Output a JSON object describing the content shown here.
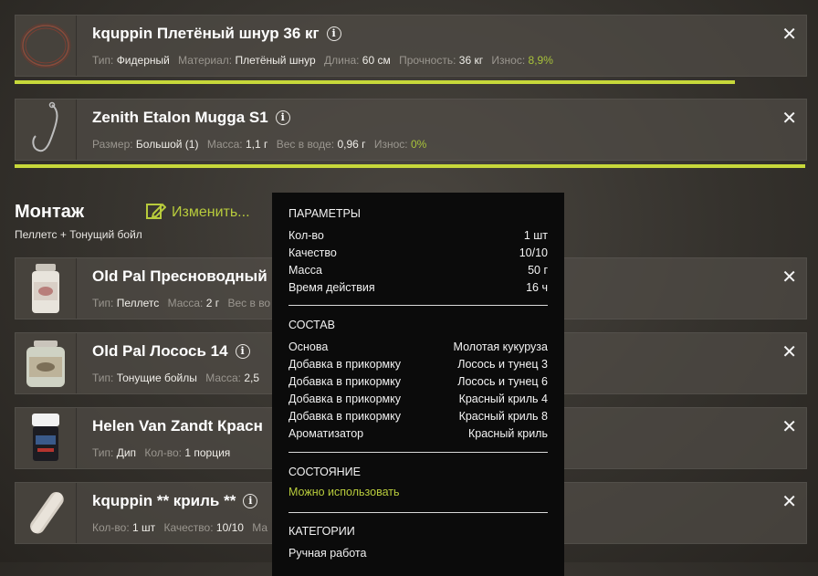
{
  "items": [
    {
      "title": "kquppin Плетёный шнур 36 кг",
      "meta": [
        {
          "k": "Тип:",
          "v": "Фидерный"
        },
        {
          "k": "Материал:",
          "v": "Плетёный шнур"
        },
        {
          "k": "Длина:",
          "v": "60 см"
        },
        {
          "k": "Прочность:",
          "v": "36 кг"
        },
        {
          "k": "Износ:",
          "v": "8,9%",
          "green": true
        }
      ],
      "wear_remaining": 0.91
    },
    {
      "title": "Zenith Etalon Mugga S1",
      "meta": [
        {
          "k": "Размер:",
          "v": "Большой (1)"
        },
        {
          "k": "Масса:",
          "v": "1,1 г"
        },
        {
          "k": "Вес в воде:",
          "v": "0,96 г"
        },
        {
          "k": "Износ:",
          "v": "0%",
          "green": true
        }
      ],
      "wear_remaining": 1.0
    }
  ],
  "montage": {
    "title": "Монтаж",
    "edit_label": "Изменить...",
    "subtitle": "Пеллетс + Тонущий бойл"
  },
  "baits": [
    {
      "title": "Old Pal Пресноводный",
      "meta": [
        {
          "k": "Тип:",
          "v": "Пеллетс"
        },
        {
          "k": "Масса:",
          "v": "2 г"
        },
        {
          "k": "Вес в во",
          "v": ""
        }
      ]
    },
    {
      "title": "Old Pal Лосось 14",
      "meta": [
        {
          "k": "Тип:",
          "v": "Тонущие бойлы"
        },
        {
          "k": "Масса:",
          "v": "2,5"
        }
      ]
    },
    {
      "title": "Helen Van Zandt Красн",
      "meta": [
        {
          "k": "Тип:",
          "v": "Дип"
        },
        {
          "k": "Кол-во:",
          "v": "1 порция"
        }
      ]
    },
    {
      "title": "kquppin ** криль **",
      "meta": [
        {
          "k": "Кол-во:",
          "v": "1 шт"
        },
        {
          "k": "Качество:",
          "v": "10/10"
        },
        {
          "k": "Ма",
          "v": ""
        }
      ]
    }
  ],
  "tooltip": {
    "params_title": "ПАРАМЕТРЫ",
    "params": [
      {
        "label": "Кол-во",
        "value": "1 шт"
      },
      {
        "label": "Качество",
        "value": "10/10"
      },
      {
        "label": "Масса",
        "value": "50 г"
      },
      {
        "label": "Время действия",
        "value": "16 ч"
      }
    ],
    "composition_title": "СОСТАВ",
    "composition": [
      {
        "label": "Основа",
        "value": "Молотая кукуруза"
      },
      {
        "label": "Добавка в прикормку",
        "value": "Лосось и тунец 3"
      },
      {
        "label": "Добавка в прикормку",
        "value": "Лосось и тунец 6"
      },
      {
        "label": "Добавка в прикормку",
        "value": "Красный криль 4"
      },
      {
        "label": "Добавка в прикормку",
        "value": "Красный криль 8"
      },
      {
        "label": "Ароматизатор",
        "value": "Красный криль"
      }
    ],
    "state_title": "СОСТОЯНИЕ",
    "state_value": "Можно использовать",
    "categories_title": "КАТЕГОРИИ",
    "categories_value": "Ручная работа"
  },
  "icons": {
    "close": "close-icon",
    "info": "info-icon",
    "edit": "edit-icon"
  },
  "colors": {
    "accent": "#c7d83a",
    "green_text": "#a8c23a"
  }
}
